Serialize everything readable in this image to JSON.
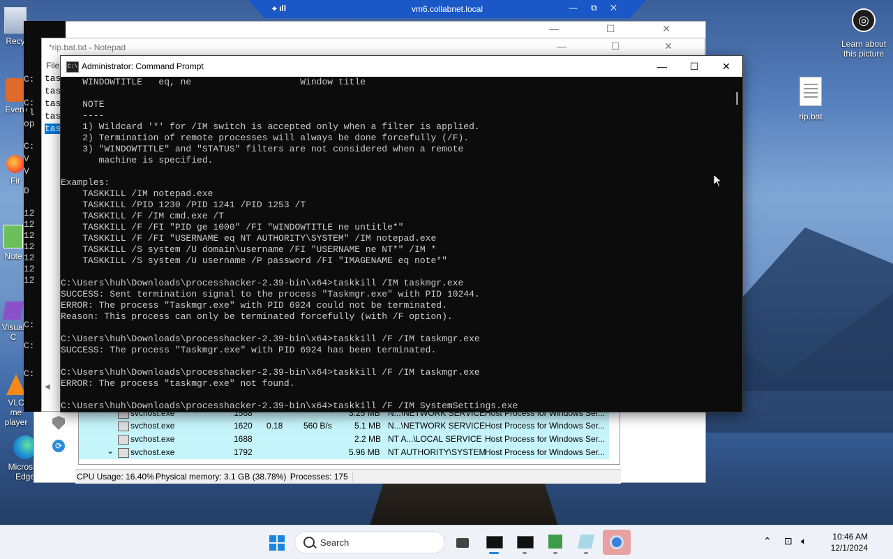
{
  "vm_bar": {
    "title": "vm6.collabnet.local",
    "left_icons": "⌖ ıll",
    "right_controls": "— ⧉ ✕"
  },
  "desktop": {
    "icons": [
      {
        "label": "Recy"
      },
      {
        "label": "Even"
      },
      {
        "label": "Fir"
      },
      {
        "label": "Note"
      },
      {
        "label": "Visual C"
      },
      {
        "label": "VLC me player"
      },
      {
        "label": "Microsoft Edge"
      }
    ],
    "learn_label": "Learn about this picture",
    "ripbat_label": "rip.bat"
  },
  "left_cmd_lines": [
    "C:",
    "C:",
    "'l",
    "op",
    "C:",
    "V",
    "V",
    "D",
    "12",
    "12",
    "12",
    "12",
    "12",
    "12",
    "12",
    "C:",
    "C:",
    "C:"
  ],
  "notepad": {
    "title": "*rip.bat.txt - Notepad",
    "menu": "File",
    "lines": [
      "tas",
      "tas",
      "tas",
      "tas",
      "tas"
    ],
    "selected_index": 4
  },
  "cmd": {
    "title": "Administrator: Command Prompt",
    "minimize": "—",
    "maximize": "☐",
    "close": "✕",
    "lines": [
      "    WINDOWTITLE   eq, ne                    Window title",
      "",
      "    NOTE",
      "    ----",
      "    1) Wildcard '*' for /IM switch is accepted only when a filter is applied.",
      "    2) Termination of remote processes will always be done forcefully (/F).",
      "    3) \"WINDOWTITLE\" and \"STATUS\" filters are not considered when a remote",
      "       machine is specified.",
      "",
      "Examples:",
      "    TASKKILL /IM notepad.exe",
      "    TASKKILL /PID 1230 /PID 1241 /PID 1253 /T",
      "    TASKKILL /F /IM cmd.exe /T",
      "    TASKKILL /F /FI \"PID ge 1000\" /FI \"WINDOWTITLE ne untitle*\"",
      "    TASKKILL /F /FI \"USERNAME eq NT AUTHORITY\\SYSTEM\" /IM notepad.exe",
      "    TASKKILL /S system /U domain\\username /FI \"USERNAME ne NT*\" /IM *",
      "    TASKKILL /S system /U username /P password /FI \"IMAGENAME eq note*\"",
      "",
      "C:\\Users\\huh\\Downloads\\processhacker-2.39-bin\\x64>taskkill /IM taskmgr.exe",
      "SUCCESS: Sent termination signal to the process \"Taskmgr.exe\" with PID 10244.",
      "ERROR: The process \"Taskmgr.exe\" with PID 6924 could not be terminated.",
      "Reason: This process can only be terminated forcefully (with /F option).",
      "",
      "C:\\Users\\huh\\Downloads\\processhacker-2.39-bin\\x64>taskkill /F /IM taskmgr.exe",
      "SUCCESS: The process \"Taskmgr.exe\" with PID 6924 has been terminated.",
      "",
      "C:\\Users\\huh\\Downloads\\processhacker-2.39-bin\\x64>taskkill /F /IM taskmgr.exe",
      "ERROR: The process \"taskmgr.exe\" not found.",
      "",
      "C:\\Users\\huh\\Downloads\\processhacker-2.39-bin\\x64>taskkill /F /IM SystemSettings.exe"
    ]
  },
  "processhacker": {
    "rows": [
      {
        "name": "svchost.exe",
        "pid": "1568",
        "cpu": "",
        "io": "",
        "mem": "3.25 MB",
        "user": "N...\\NETWORK SERVICE",
        "desc": "Host Process for Windows Ser...",
        "expander": ""
      },
      {
        "name": "svchost.exe",
        "pid": "1620",
        "cpu": "0.18",
        "io": "560 B/s",
        "mem": "5.1 MB",
        "user": "N...\\NETWORK SERVICE",
        "desc": "Host Process for Windows Ser...",
        "expander": ""
      },
      {
        "name": "svchost.exe",
        "pid": "1688",
        "cpu": "",
        "io": "",
        "mem": "2.2 MB",
        "user": "NT A...\\LOCAL SERVICE",
        "desc": "Host Process for Windows Ser...",
        "expander": ""
      },
      {
        "name": "svchost.exe",
        "pid": "1792",
        "cpu": "",
        "io": "",
        "mem": "5.96 MB",
        "user": "NT AUTHORITY\\SYSTEM",
        "desc": "Host Process for Windows Ser...",
        "expander": "⌄"
      }
    ],
    "status": {
      "cpu": "CPU Usage: 16.40%",
      "memory": "Physical memory: 3.1 GB (38.78%)",
      "processes": "Processes: 175"
    }
  },
  "taskbar": {
    "search_label": "Search",
    "time": "10:46 AM",
    "date": "12/1/2024"
  }
}
